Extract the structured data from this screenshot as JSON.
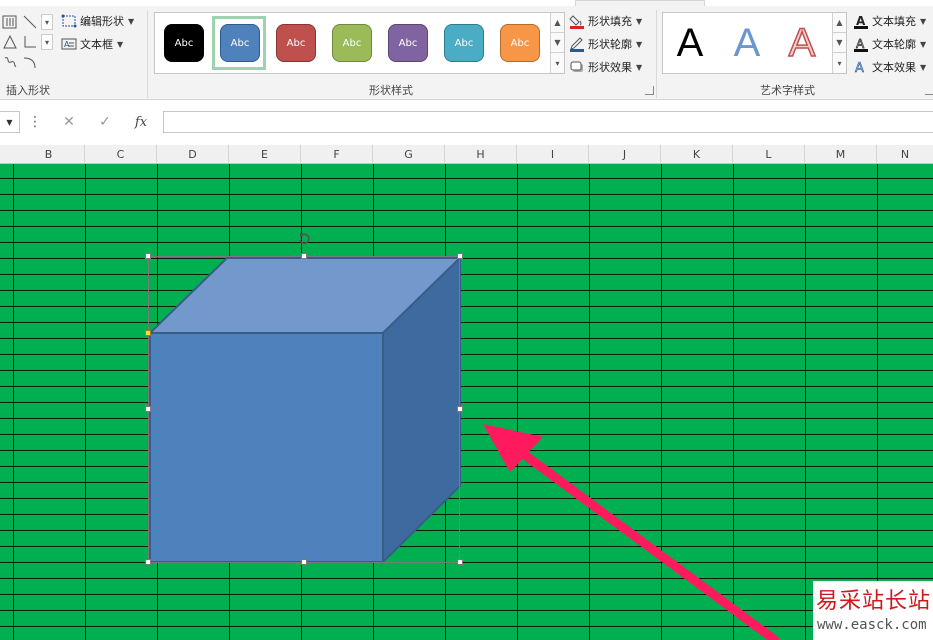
{
  "ribbon": {
    "insert_shapes": {
      "group_label": "插入形状",
      "edit_shape_label": "编辑形状",
      "text_box_label": "文本框",
      "icons": [
        "textbox-vertical-icon",
        "line-icon",
        "scroll-down-icon",
        "triangle-icon",
        "elbow-connector-icon",
        "scroll-more-icon",
        "freeform-icon",
        "arc-icon",
        "edit-shape-icon",
        "text-box-icon"
      ]
    },
    "shape_styles": {
      "group_label": "形状样式",
      "fill_label": "形状填充",
      "outline_label": "形状轮廓",
      "effects_label": "形状效果",
      "presets": [
        {
          "label": "Abc",
          "color": "#000000"
        },
        {
          "label": "Abc",
          "color": "#4f81bd"
        },
        {
          "label": "Abc",
          "color": "#c0504d"
        },
        {
          "label": "Abc",
          "color": "#9bbb59"
        },
        {
          "label": "Abc",
          "color": "#8064a2"
        },
        {
          "label": "Abc",
          "color": "#4bacc6"
        },
        {
          "label": "Abc",
          "color": "#f79646"
        }
      ],
      "selected_index": 1
    },
    "wordart_styles": {
      "group_label": "艺术字样式",
      "text_fill_label": "文本填充",
      "text_outline_label": "文本轮廓",
      "text_effects_label": "文本效果",
      "presets": [
        {
          "label": "A",
          "color": "#000000"
        },
        {
          "label": "A",
          "color": "#4f81bd"
        },
        {
          "label": "A",
          "color": "#f2dcdb"
        }
      ]
    }
  },
  "formula_bar": {
    "cancel_label": "✕",
    "enter_label": "✓",
    "fx_label": "fx",
    "dots_label": "⋮",
    "value": ""
  },
  "columns": [
    "B",
    "C",
    "D",
    "E",
    "F",
    "G",
    "H",
    "I",
    "J",
    "K",
    "L",
    "M",
    "N"
  ],
  "sheet": {
    "background_color": "#00b050",
    "shape": {
      "type": "cube",
      "front_color": "#4f81bd",
      "top_color": "#7399cc",
      "side_color": "#3f6aa0"
    },
    "arrow_color": "#ff1a5e"
  },
  "watermark": {
    "title": "易采站长站",
    "url": "www.easck.com"
  }
}
